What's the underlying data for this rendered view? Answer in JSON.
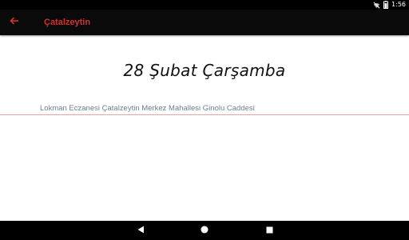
{
  "status_bar": {
    "time": "1:56",
    "icons": [
      "wifi-off-icon",
      "battery-icon"
    ]
  },
  "app_bar": {
    "title": "Çatalzeytin",
    "back_icon": "arrow-back-icon",
    "accent_color": "#d32f2f",
    "background_color": "#0a0a0a"
  },
  "main": {
    "date_heading": "28 Şubat Çarşamba",
    "pharmacies": [
      {
        "label": "Lokman Eczanesi Çatalzeytin Merkez Mahallesi Ginolu Caddesi"
      }
    ],
    "divider_color": "#e6a3a3"
  },
  "nav_bar": {
    "buttons": [
      "back-triangle-icon",
      "home-circle-icon",
      "recents-square-icon"
    ]
  }
}
